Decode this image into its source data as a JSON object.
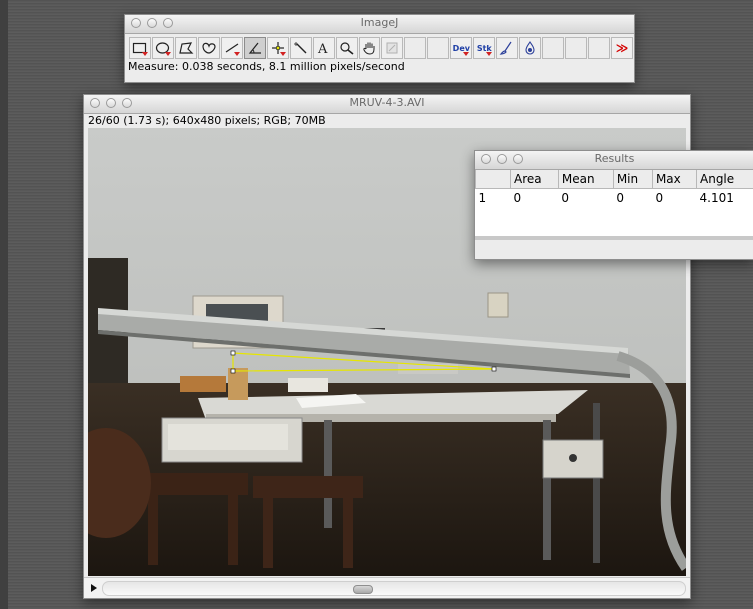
{
  "imagej": {
    "title": "ImageJ",
    "status": "Measure: 0.038 seconds, 8.1 million pixels/second",
    "tools": [
      {
        "name": "rectangle-tool-icon",
        "selected": false
      },
      {
        "name": "oval-tool-icon",
        "selected": false
      },
      {
        "name": "polygon-tool-icon",
        "selected": false
      },
      {
        "name": "freehand-tool-icon",
        "selected": false
      },
      {
        "name": "line-tool-icon",
        "selected": false
      },
      {
        "name": "angle-tool-icon",
        "selected": true
      },
      {
        "name": "point-tool-icon",
        "selected": false
      },
      {
        "name": "wand-tool-icon",
        "selected": false
      },
      {
        "name": "text-tool-icon",
        "selected": false
      },
      {
        "name": "magnifier-tool-icon",
        "selected": false
      },
      {
        "name": "hand-tool-icon",
        "selected": false
      },
      {
        "name": "color-picker-tool-icon",
        "selected": false
      }
    ],
    "dev_label": "Dev",
    "stk_label": "Stk",
    "more_label": "≫"
  },
  "image_window": {
    "title": "MRUV-4-3.AVI",
    "info": "26/60 (1.73 s); 640x480 pixels; RGB; 70MB",
    "angle_line_color": "#e6e600"
  },
  "results": {
    "title": "Results",
    "columns": [
      "",
      "Area",
      "Mean",
      "Min",
      "Max",
      "Angle"
    ],
    "rows": [
      [
        "1",
        "0",
        "0",
        "0",
        "0",
        "4.101"
      ]
    ]
  }
}
